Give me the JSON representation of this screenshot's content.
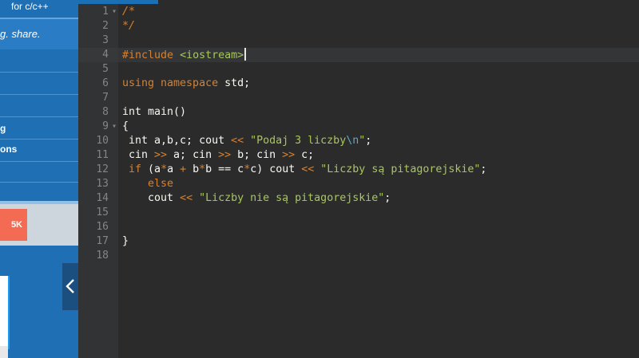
{
  "sidebar": {
    "top_text": "for c/c++",
    "tagline": "g. share.",
    "items": [
      {
        "label": ""
      },
      {
        "label": ""
      },
      {
        "label": ""
      },
      {
        "label": "g"
      },
      {
        "label": "ons"
      },
      {
        "label": ""
      }
    ],
    "badge": "5K"
  },
  "editor": {
    "line_numbers": [
      "1",
      "2",
      "3",
      "4",
      "5",
      "6",
      "7",
      "8",
      "9",
      "10",
      "11",
      "12",
      "13",
      "14",
      "15",
      "16",
      "17",
      "18"
    ],
    "fold_markers": {
      "1": "▾",
      "9": "▾"
    },
    "active_line": 4,
    "lines": {
      "l1": "/*",
      "l2": "*/",
      "l4_pp": "#include",
      "l4_inc": "<iostream>",
      "l6_kw": "using namespace",
      "l6_rest": " std;",
      "l8": "int main()",
      "l9": "{",
      "l10_a": " int a,b,c; cout ",
      "l10_op": "<<",
      "l10_str1": " \"Podaj 3 liczby",
      "l10_esc": "\\n",
      "l10_str2": "\"",
      "l10_end": ";",
      "l11_a": " cin ",
      "l11_op1": ">>",
      "l11_b": " a; cin ",
      "l11_op2": ">>",
      "l11_c": " b; cin ",
      "l11_op3": ">>",
      "l11_d": " c;",
      "l12_kw": " if",
      "l12_a": " (a",
      "l12_op1": "*",
      "l12_b": "a ",
      "l12_op2": "+",
      "l12_c": " b",
      "l12_op3": "*",
      "l12_d": "b == c",
      "l12_op4": "*",
      "l12_e": "c) cout ",
      "l12_op5": "<<",
      "l12_str": " \"Liczby są pitagorejskie\"",
      "l12_end": ";",
      "l13_kw": "    else",
      "l14_a": "    cout ",
      "l14_op": "<<",
      "l14_str": " \"Liczby nie są pitagorejskie\"",
      "l14_end": ";",
      "l17": "}"
    }
  }
}
